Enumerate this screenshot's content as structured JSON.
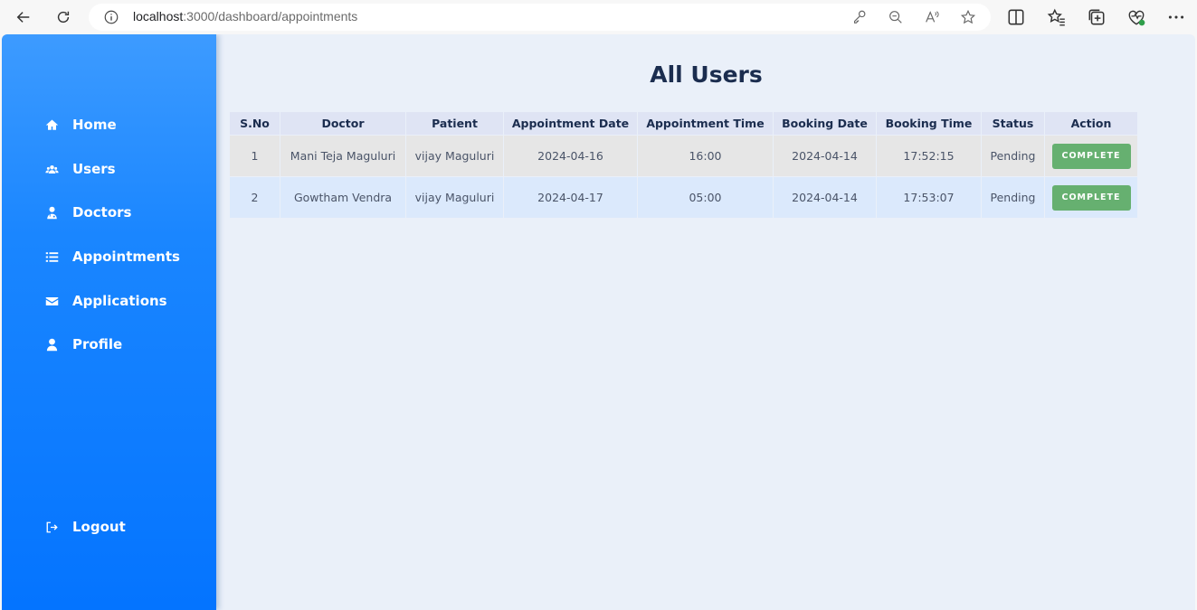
{
  "browser": {
    "url_host": "localhost",
    "url_path": ":3000/dashboard/appointments"
  },
  "sidebar": {
    "items": [
      {
        "label": "Home",
        "icon": "home-icon"
      },
      {
        "label": "Users",
        "icon": "users-icon"
      },
      {
        "label": "Doctors",
        "icon": "doctor-icon"
      },
      {
        "label": "Appointments",
        "icon": "list-icon"
      },
      {
        "label": "Applications",
        "icon": "envelope-icon"
      },
      {
        "label": "Profile",
        "icon": "user-icon"
      }
    ],
    "logout": {
      "label": "Logout",
      "icon": "logout-icon"
    }
  },
  "main": {
    "title": "All Users",
    "table": {
      "headers": [
        "S.No",
        "Doctor",
        "Patient",
        "Appointment Date",
        "Appointment Time",
        "Booking Date",
        "Booking Time",
        "Status",
        "Action"
      ],
      "rows": [
        {
          "sno": "1",
          "doctor": "Mani Teja Maguluri",
          "patient": "vijay Maguluri",
          "appointment_date": "2024-04-16",
          "appointment_time": "16:00",
          "booking_date": "2024-04-14",
          "booking_time": "17:52:15",
          "status": "Pending",
          "action": "COMPLETE"
        },
        {
          "sno": "2",
          "doctor": "Gowtham Vendra",
          "patient": "vijay Maguluri",
          "appointment_date": "2024-04-17",
          "appointment_time": "05:00",
          "booking_date": "2024-04-14",
          "booking_time": "17:53:07",
          "status": "Pending",
          "action": "COMPLETE"
        }
      ]
    }
  },
  "colors": {
    "sidebar_top": "#3d9bff",
    "sidebar_bottom": "#0474ff",
    "title": "#1b2d4f",
    "complete_button": "#66b070"
  }
}
